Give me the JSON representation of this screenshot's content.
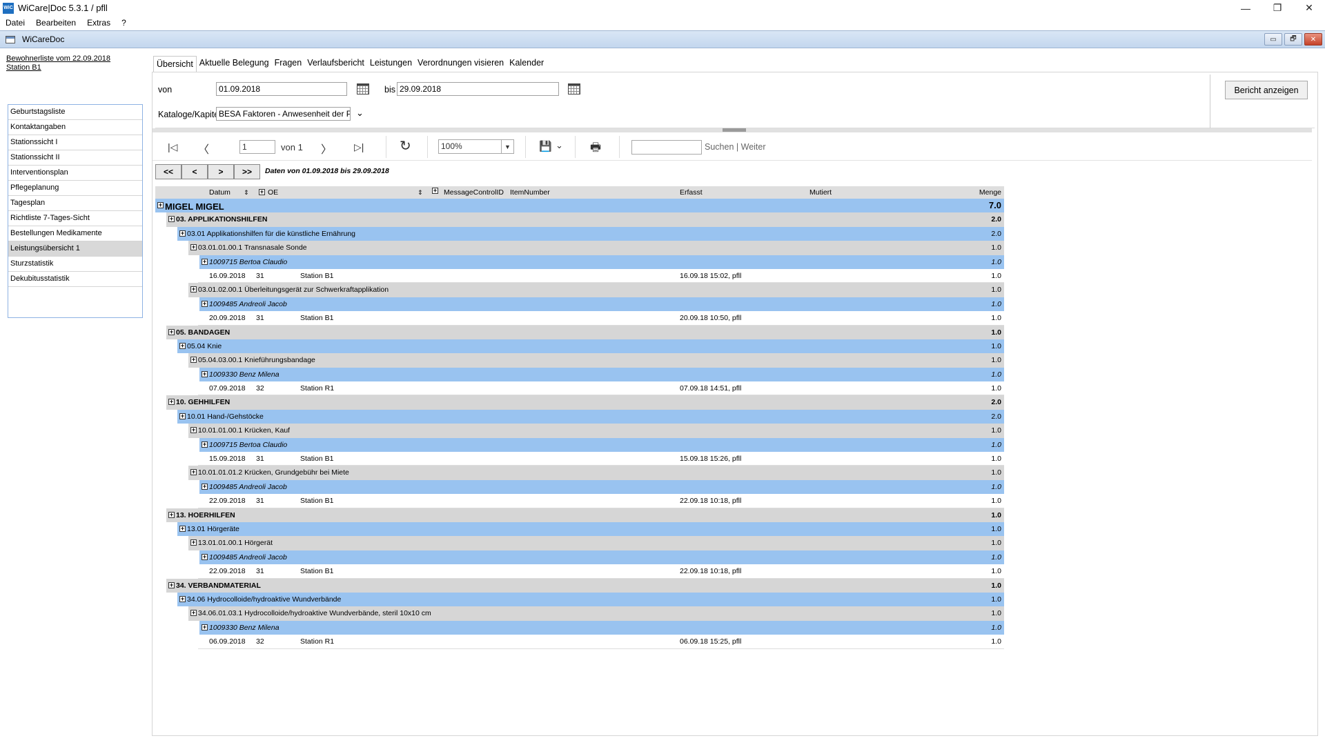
{
  "window": {
    "title": "WiCare|Doc 5.3.1  / pfll",
    "icon_text": "WiC",
    "minimize": "—",
    "maximize": "❐",
    "close": "✕"
  },
  "menu": [
    "Datei",
    "Bearbeiten",
    "Extras",
    "?"
  ],
  "mdi": {
    "title": "WiCareDoc",
    "min": "▭",
    "restore": "🗗",
    "close": "✕"
  },
  "sidebar": {
    "resident_line1": "Bewohnerliste vom 22.09.2018",
    "resident_line2": "Station B1",
    "items": [
      "Geburtstagsliste",
      "Kontaktangaben",
      "Stationssicht I",
      "Stationssicht II",
      "Interventionsplan",
      "Pflegeplanung",
      "Tagesplan",
      "Richtliste 7-Tages-Sicht",
      "Bestellungen Medikamente",
      "Leistungsübersicht 1",
      "Sturzstatistik",
      "Dekubitusstatistik"
    ],
    "active_index": 9
  },
  "tabs": [
    "Übersicht",
    "Aktuelle Belegung",
    "Fragen",
    "Verlaufsbericht",
    "Leistungen",
    "Verordnungen visieren",
    "Kalender"
  ],
  "params": {
    "von_label": "von",
    "von_value": "01.09.2018",
    "bis_label": "bis",
    "bis_value": "29.09.2018",
    "katalog_label": "Kataloge/Kapitel",
    "katalog_value": "BESA Faktoren - Anwesenheit der Pfleg",
    "report_button": "Bericht anzeigen"
  },
  "toolbar": {
    "first": "|◁",
    "prev": "〈",
    "page": "1",
    "of_label": "von 1",
    "next": "〉",
    "last": "▷|",
    "refresh": "↻",
    "zoom": "100%",
    "save": "💾",
    "save_dropdown": "⌄",
    "print": "🖶",
    "search_label": "Suchen",
    "separator": "|",
    "next_label": "Weiter"
  },
  "report": {
    "nav_buttons": [
      "<<",
      "<",
      ">",
      ">>"
    ],
    "range_text": "Daten von 01.09.2018 bis 29.09.2018",
    "headers": {
      "datum": "Datum",
      "oe": "OE",
      "msgid": "MessageControlID",
      "item": "ItemNumber",
      "erfasst": "Erfasst",
      "mutiert": "Mutiert",
      "menge": "Menge"
    },
    "rows": [
      {
        "level": 0,
        "label": "MIGEL MIGEL",
        "qty": "7.0"
      },
      {
        "level": 1,
        "label": "03. APPLIKATIONSHILFEN",
        "qty": "2.0"
      },
      {
        "level": 2,
        "label": "03.01 Applikationshilfen für die künstliche Ernährung",
        "qty": "2.0"
      },
      {
        "level": 3,
        "label": "03.01.01.00.1 Transnasale Sonde",
        "qty": "1.0"
      },
      {
        "level": 4,
        "label": "1009715 Bertoa Claudio",
        "qty": "1.0"
      },
      {
        "level": 5,
        "date": "16.09.2018",
        "oe": "31",
        "station": "Station B1",
        "erfasst": "16.09.18 15:02, pfll",
        "qty": "1.0"
      },
      {
        "level": 3,
        "label": "03.01.02.00.1 Überleitungsgerät zur Schwerkraftapplikation",
        "qty": "1.0"
      },
      {
        "level": 4,
        "label": "1009485 Andreoli Jacob",
        "qty": "1.0"
      },
      {
        "level": 5,
        "date": "20.09.2018",
        "oe": "31",
        "station": "Station B1",
        "erfasst": "20.09.18 10:50, pfll",
        "qty": "1.0"
      },
      {
        "level": 1,
        "label": "05. BANDAGEN",
        "qty": "1.0"
      },
      {
        "level": 2,
        "label": "05.04 Knie",
        "qty": "1.0"
      },
      {
        "level": 3,
        "label": "05.04.03.00.1 Knieführungsbandage",
        "qty": "1.0"
      },
      {
        "level": 4,
        "label": "1009330 Benz Milena",
        "qty": "1.0"
      },
      {
        "level": 5,
        "date": "07.09.2018",
        "oe": "32",
        "station": "Station R1",
        "erfasst": "07.09.18 14:51, pfll",
        "qty": "1.0"
      },
      {
        "level": 1,
        "label": "10. GEHHILFEN",
        "qty": "2.0"
      },
      {
        "level": 2,
        "label": "10.01 Hand-/Gehstöcke",
        "qty": "2.0"
      },
      {
        "level": 3,
        "label": "10.01.01.00.1 Krücken, Kauf",
        "qty": "1.0"
      },
      {
        "level": 4,
        "label": "1009715 Bertoa Claudio",
        "qty": "1.0"
      },
      {
        "level": 5,
        "date": "15.09.2018",
        "oe": "31",
        "station": "Station B1",
        "erfasst": "15.09.18 15:26, pfll",
        "qty": "1.0"
      },
      {
        "level": 3,
        "label": "10.01.01.01.2 Krücken, Grundgebühr bei Miete",
        "qty": "1.0"
      },
      {
        "level": 4,
        "label": "1009485 Andreoli Jacob",
        "qty": "1.0"
      },
      {
        "level": 5,
        "date": "22.09.2018",
        "oe": "31",
        "station": "Station B1",
        "erfasst": "22.09.18 10:18, pfll",
        "qty": "1.0"
      },
      {
        "level": 1,
        "label": "13. HOERHILFEN",
        "qty": "1.0"
      },
      {
        "level": 2,
        "label": "13.01 Hörgeräte",
        "qty": "1.0"
      },
      {
        "level": 3,
        "label": "13.01.01.00.1 Hörgerät",
        "qty": "1.0"
      },
      {
        "level": 4,
        "label": "1009485 Andreoli Jacob",
        "qty": "1.0"
      },
      {
        "level": 5,
        "date": "22.09.2018",
        "oe": "31",
        "station": "Station B1",
        "erfasst": "22.09.18 10:18, pfll",
        "qty": "1.0"
      },
      {
        "level": 1,
        "label": "34. VERBANDMATERIAL",
        "qty": "1.0"
      },
      {
        "level": 2,
        "label": "34.06 Hydrocolloide/hydroaktive Wundverbände",
        "qty": "1.0"
      },
      {
        "level": 3,
        "label": "34.06.01.03.1 Hydrocolloide/hydroaktive Wundverbände, steril 10x10 cm",
        "qty": "1.0"
      },
      {
        "level": 4,
        "label": "1009330 Benz Milena",
        "qty": "1.0"
      },
      {
        "level": 5,
        "date": "06.09.2018",
        "oe": "32",
        "station": "Station R1",
        "erfasst": "06.09.18 15:25, pfll",
        "qty": "1.0"
      }
    ]
  },
  "colors": {
    "row_blue": "#99c3f0",
    "row_gray": "#d6d6d6",
    "title_gradient": "#c3d6ee"
  }
}
